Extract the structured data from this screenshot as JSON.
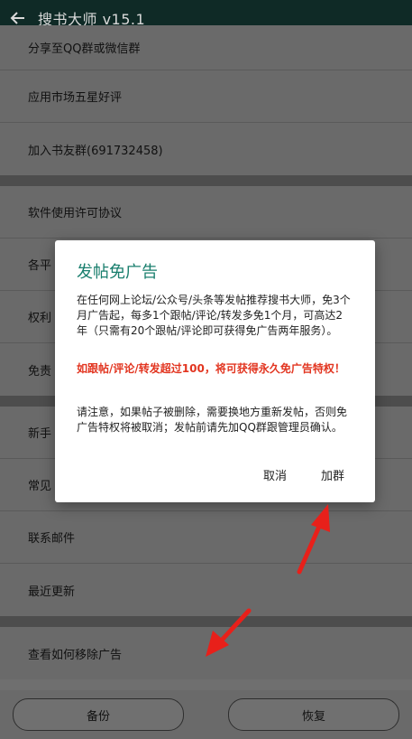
{
  "header": {
    "title": "搜书大师 v15.1"
  },
  "groups": [
    {
      "items": [
        "分享至QQ群或微信群",
        "应用市场五星好评",
        "加入书友群(691732458)"
      ]
    },
    {
      "items": [
        "软件使用许可协议",
        "各平",
        "权利",
        "免责"
      ]
    },
    {
      "items": [
        "新手",
        "常见",
        "联系邮件",
        "最近更新"
      ]
    },
    {
      "items": [
        "查看如何移除广告"
      ]
    }
  ],
  "bottom": {
    "backup_label": "备份",
    "restore_label": "恢复"
  },
  "dialog": {
    "title": "发帖免广告",
    "p1": "在任何网上论坛/公众号/头条等发帖推荐搜书大师，免3个月广告起，每多1个跟帖/评论/转发多免1个月，可高达2年（只需有20个跟帖/评论即可获得免广告两年服务）。",
    "p2": "如跟帖/评论/转发超过100，将可获得永久免广告特权！",
    "p3": "请注意，如果帖子被删除，需要换地方重新发帖，否则免广告特权将被取消；发帖前请先加QQ群跟管理员确认。",
    "cancel_label": "取消",
    "join_label": "加群"
  },
  "colors": {
    "accent": "#1a7f6e",
    "highlight": "#e23520",
    "arrow": "#e8201a"
  }
}
